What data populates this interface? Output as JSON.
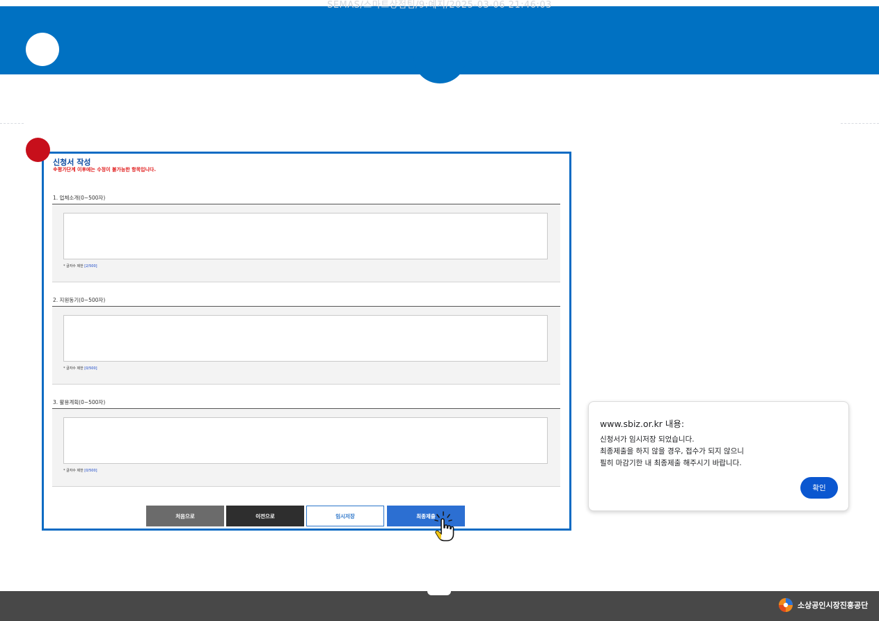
{
  "watermark": "SEMAS/스마트상점팀/9:예지/2025-03-06 21:46:03",
  "form": {
    "title": "신청서 작성",
    "notice": "※평가단계 이후에는 수정이 불가능한 항목입니다.",
    "count_prefix": "* 글자수 제한",
    "count_max": "500",
    "sections": [
      {
        "label": "1. 업체소개(0~500자)",
        "value": "",
        "count": "2"
      },
      {
        "label": "2. 지원동기(0~500자)",
        "value": "",
        "count": "0"
      },
      {
        "label": "3. 활용계획(0~500자)",
        "value": "",
        "count": "0"
      }
    ],
    "buttons": {
      "first": "처음으로",
      "prev": "이전으로",
      "temp_save": "임시저장",
      "final_submit": "최종제출"
    }
  },
  "dialog": {
    "title": "www.sbiz.or.kr 내용:",
    "lines": [
      "신청서가 임시저장 되었습니다.",
      "최종제출을 하지 않을 경우, 접수가 되지 않으니",
      "필히 마감기한 내 최종제출 해주시기 바랍니다."
    ],
    "ok_label": "확인"
  },
  "footer": {
    "org_name": "소상공인시장진흥공단"
  },
  "colors": {
    "header_blue": "#0071c2",
    "frame_blue": "#0b6bc3",
    "marker_red": "#c70f1b",
    "notice_red": "#e01818",
    "dialog_button": "#0b57d0",
    "footer_gray": "#484848"
  },
  "icons": {
    "header_marker": "white-circle-icon",
    "step_marker": "red-circle-icon",
    "cursor": "hand-pointer-click-icon",
    "org_logo": "semas-logo-icon"
  }
}
